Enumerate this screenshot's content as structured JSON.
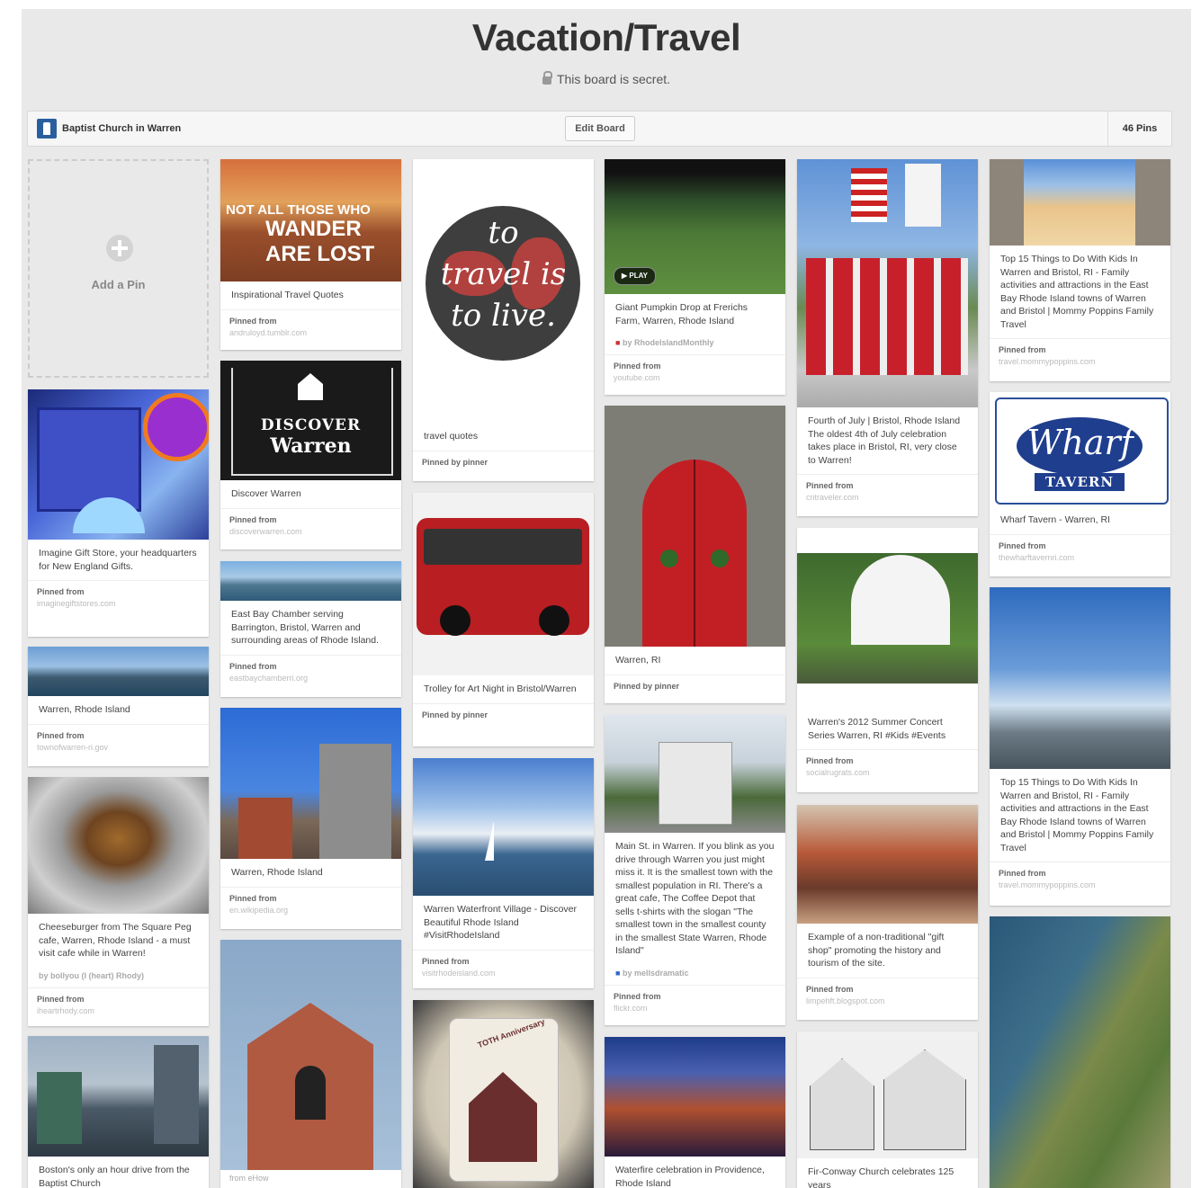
{
  "board": {
    "title": "Vacation/Travel",
    "secret_text": "This board is secret.",
    "owner_name": "Baptist Church in Warren",
    "edit_button": "Edit Board",
    "pins_count": "46 Pins"
  },
  "add_pin": {
    "label": "Add a Pin"
  },
  "pins": [
    {
      "desc": "Imagine Gift Store, your headquarters for New England Gifts.",
      "src_label": "Pinned from",
      "src": "imaginegiftstores.com"
    },
    {
      "desc": "Warren, Rhode Island",
      "src_label": "Pinned from",
      "src": "townofwarren-ri.gov"
    },
    {
      "desc": "Cheeseburger from The Square Peg cafe, Warren, Rhode Island - a must visit cafe while in Warren!",
      "by": "by bollyou (I (heart) Rhody)",
      "src_label": "Pinned from",
      "src": "iheartrhody.com"
    },
    {
      "desc": "Boston's only an hour drive from the Baptist Church"
    },
    {
      "desc": "Inspirational Travel Quotes",
      "src_label": "Pinned from",
      "src": "andruloyd.tumblr.com",
      "overlay1": "NOT ALL THOSE WHO",
      "overlay2": "WANDER ARE LOST"
    },
    {
      "desc": "Discover Warren",
      "src_label": "Pinned from",
      "src": "discoverwarren.com",
      "overlay1": "DISCOVER",
      "overlay2": "Warren"
    },
    {
      "desc": "East Bay Chamber serving Barrington, Bristol, Warren and surrounding areas of Rhode Island.",
      "src_label": "Pinned from",
      "src": "eastbaychamberri.org"
    },
    {
      "desc": "Warren, Rhode Island",
      "src_label": "Pinned from",
      "src": "en.wikipedia.org"
    },
    {
      "src": "from eHow"
    },
    {
      "desc": "travel quotes",
      "src_label": "Pinned by pinner",
      "overlay1": "to",
      "overlay2": "travel is",
      "overlay3": "to live."
    },
    {
      "desc": "Trolley for Art Night in Bristol/Warren",
      "src_label": "Pinned by pinner"
    },
    {
      "desc": "Warren Waterfront Village - Discover Beautiful Rhode Island #VisitRhodeIsland",
      "src_label": "Pinned from",
      "src": "visitrhodeisland.com"
    },
    {
      "overlay1": "TOTH Anniversary"
    },
    {
      "desc": "Giant Pumpkin Drop at Frerichs Farm, Warren, Rhode Island",
      "by": "by RhodelslandMonthly",
      "src_label": "Pinned from",
      "src": "youtube.com",
      "play": "PLAY"
    },
    {
      "desc": "Warren, RI",
      "src_label": "Pinned by pinner"
    },
    {
      "desc": "Main St. in Warren. If you blink as you drive through Warren you just might miss it. It is the smallest town with the smallest population in RI. There's a great cafe, The Coffee Depot that sells t-shirts with the slogan \"The smallest town in the smallest county in the smallest State Warren, Rhode Island\"",
      "by": "by mellsdramatic",
      "src_label": "Pinned from",
      "src": "flickr.com"
    },
    {
      "desc": "Waterfire celebration in Providence, Rhode Island"
    },
    {
      "desc": "Fourth of July | Bristol, Rhode Island The oldest 4th of July celebration takes place in Bristol, RI, very close to Warren!",
      "src_label": "Pinned from",
      "src": "cntraveler.com"
    },
    {
      "desc": "Warren's 2012 Summer Concert Series Warren, RI #Kids #Events",
      "src_label": "Pinned from",
      "src": "socialrugrats.com"
    },
    {
      "desc": "Example of a non-traditional \"gift shop\" promoting the history and tourism of the site.",
      "src_label": "Pinned from",
      "src": "limpehft.blogspot.com"
    },
    {
      "desc": "Fir-Conway Church celebrates 125 years"
    },
    {
      "desc": "Top 15 Things to Do With Kids In Warren and Bristol, RI - Family activities and attractions in the East Bay Rhode Island towns of Warren and Bristol | Mommy Poppins Family Travel",
      "src_label": "Pinned from",
      "src": "travel.mommypoppins.com"
    },
    {
      "desc": "Wharf Tavern - Warren, RI",
      "src_label": "Pinned from",
      "src": "thewharftavernri.com",
      "overlay1": "Wharf",
      "overlay2": "TAVERN"
    },
    {
      "desc": "Top 15 Things to Do With Kids In Warren and Bristol, RI - Family activities and attractions in the East Bay Rhode Island towns of Warren and Bristol | Mommy Poppins Family Travel",
      "src_label": "Pinned from",
      "src": "travel.mommypoppins.com"
    },
    {}
  ]
}
